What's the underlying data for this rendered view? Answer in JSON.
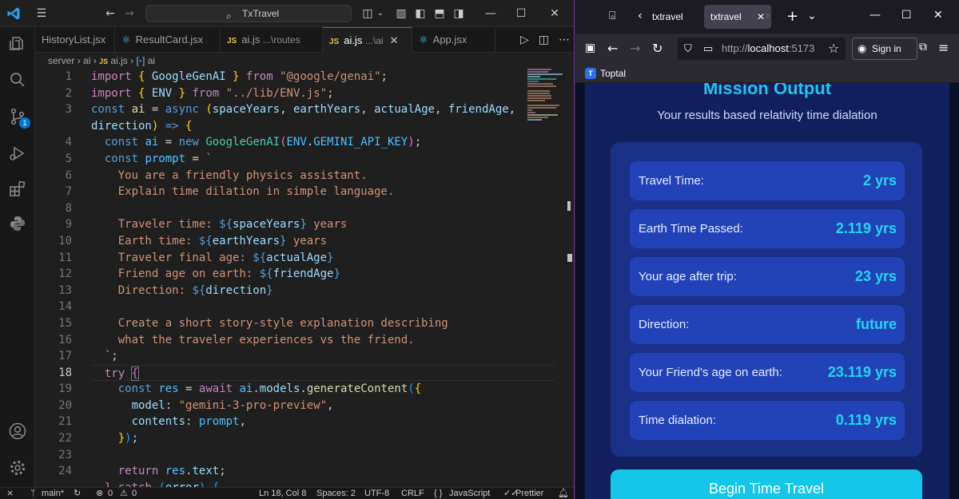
{
  "vscode": {
    "search_text": "TxTravel",
    "tabs": [
      {
        "label": "HistoryList.jsx",
        "type": "react"
      },
      {
        "label": "ResultCard.jsx",
        "type": "react"
      },
      {
        "label": "ai.js",
        "suffix": "...\\routes",
        "type": "js"
      },
      {
        "label": "ai.js",
        "suffix": "...\\ai",
        "type": "js",
        "active": true
      },
      {
        "label": "App.jsx",
        "type": "react"
      }
    ],
    "breadcrumb": {
      "part1": "server",
      "part2": "ai",
      "part3": "ai.js",
      "part4": "ai"
    },
    "scm_badge": "1",
    "line_numbers": [
      "1",
      "2",
      "3",
      "",
      "4",
      "5",
      "6",
      "7",
      "8",
      "9",
      "10",
      "11",
      "12",
      "13",
      "14",
      "15",
      "16",
      "17",
      "18",
      "19",
      "20",
      "21",
      "22",
      "23",
      "24",
      ""
    ],
    "current_line": "18",
    "status": {
      "branch": "main*",
      "errors": "0",
      "warnings": "0",
      "position": "Ln 18, Col 8",
      "spaces": "Spaces: 2",
      "encoding": "UTF-8",
      "eol": "CRLF",
      "language": "JavaScript",
      "formatter": "Prettier"
    }
  },
  "browser": {
    "tab_inactive": "txtravel",
    "tab_active": "txtravel",
    "url_prefix": "http://",
    "url_host": "localhost",
    "url_port": ":5173",
    "sign_in": "Sign in",
    "bookmark": "Toptal",
    "app": {
      "title": "Mission Output",
      "subtitle": "Your results based relativity time dialation",
      "rows": [
        {
          "label": "Travel Time:",
          "value": "2 yrs"
        },
        {
          "label": "Earth Time Passed:",
          "value": "2.119 yrs"
        },
        {
          "label": "Your age after trip:",
          "value": "23 yrs"
        },
        {
          "label": "Direction:",
          "value": "future"
        },
        {
          "label": "Your Friend's age on earth:",
          "value": "23.119 yrs"
        },
        {
          "label": "Time dialation:",
          "value": "0.119 yrs"
        }
      ],
      "button": "Begin Time Travel"
    }
  }
}
